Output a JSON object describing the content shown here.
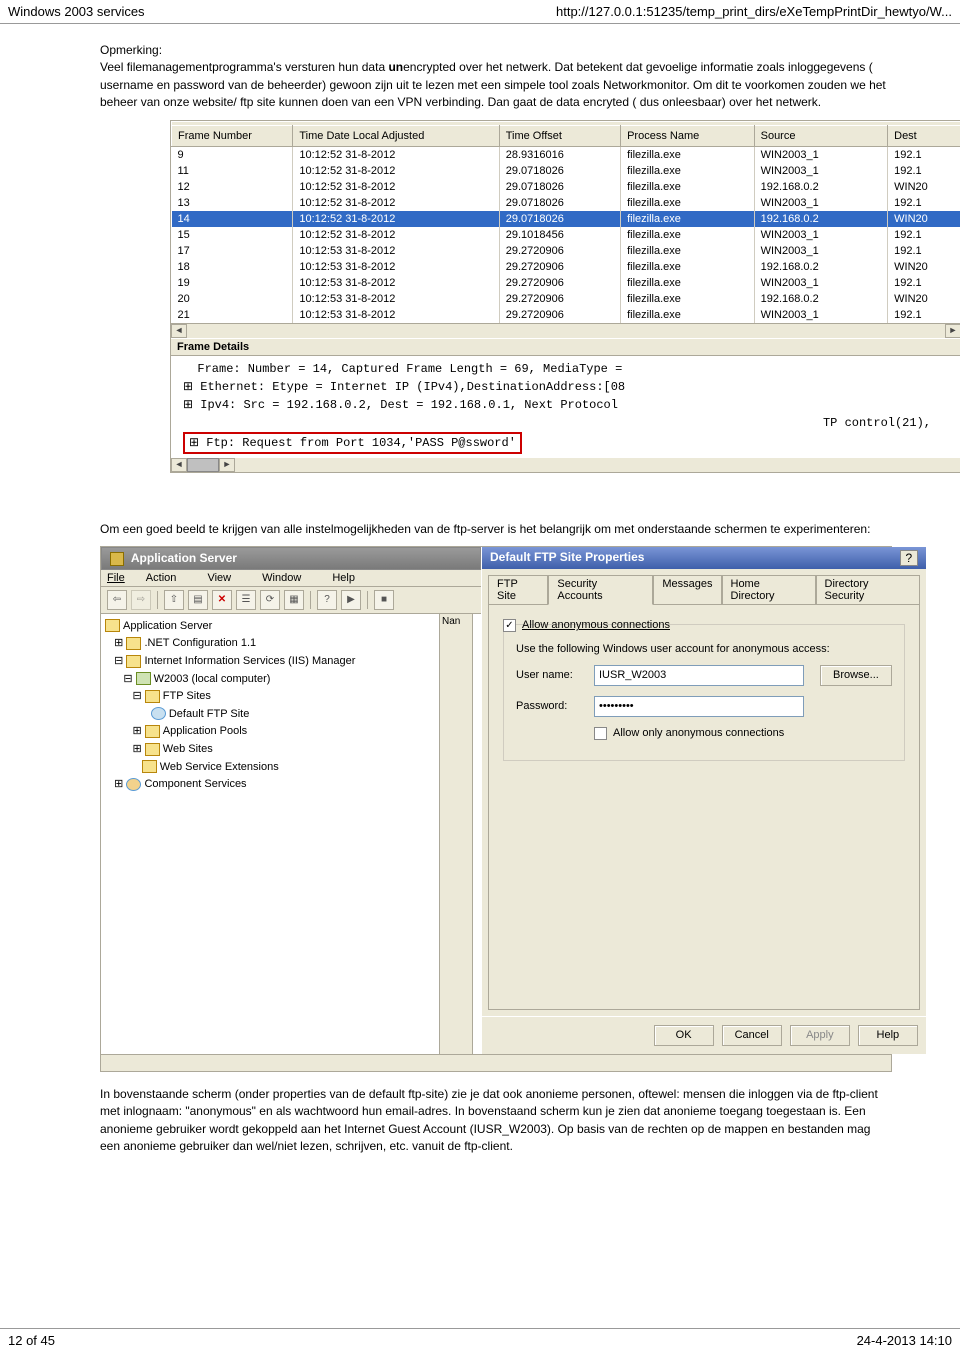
{
  "header": {
    "title": "Windows 2003 services",
    "url": "http://127.0.0.1:51235/temp_print_dirs/eXeTempPrintDir_hewtyo/W..."
  },
  "intro": {
    "label": "Opmerking:",
    "text_pre": "Veel filemanagementprogramma's versturen hun data ",
    "text_bold": "un",
    "text_post": "encrypted over het netwerk. Dat betekent dat gevoelige informatie zoals inloggegevens ( username en password van de beheerder) gewoon zijn uit te lezen met een simpele tool zoals Networkmonitor. Om dit te voorkomen zouden we het beheer van onze website/ ftp site kunnen doen van een VPN verbinding. Dan gaat de data encryted ( dus onleesbaar) over het netwerk."
  },
  "netmon": {
    "columns": [
      "Frame Number",
      "Time Date Local Adjusted",
      "Time Offset",
      "Process Name",
      "Source",
      "Dest"
    ],
    "rows": [
      [
        "9",
        "10:12:52 31-8-2012",
        "28.9316016",
        "filezilla.exe",
        "WIN2003_1",
        "192.1"
      ],
      [
        "11",
        "10:12:52 31-8-2012",
        "29.0718026",
        "filezilla.exe",
        "WIN2003_1",
        "192.1"
      ],
      [
        "12",
        "10:12:52 31-8-2012",
        "29.0718026",
        "filezilla.exe",
        "192.168.0.2",
        "WIN20"
      ],
      [
        "13",
        "10:12:52 31-8-2012",
        "29.0718026",
        "filezilla.exe",
        "WIN2003_1",
        "192.1"
      ],
      [
        "14",
        "10:12:52 31-8-2012",
        "29.0718026",
        "filezilla.exe",
        "192.168.0.2",
        "WIN20"
      ],
      [
        "15",
        "10:12:52 31-8-2012",
        "29.1018456",
        "filezilla.exe",
        "WIN2003_1",
        "192.1"
      ],
      [
        "17",
        "10:12:53 31-8-2012",
        "29.2720906",
        "filezilla.exe",
        "WIN2003_1",
        "192.1"
      ],
      [
        "18",
        "10:12:53 31-8-2012",
        "29.2720906",
        "filezilla.exe",
        "192.168.0.2",
        "WIN20"
      ],
      [
        "19",
        "10:12:53 31-8-2012",
        "29.2720906",
        "filezilla.exe",
        "WIN2003_1",
        "192.1"
      ],
      [
        "20",
        "10:12:53 31-8-2012",
        "29.2720906",
        "filezilla.exe",
        "192.168.0.2",
        "WIN20"
      ],
      [
        "21",
        "10:12:53 31-8-2012",
        "29.2720906",
        "filezilla.exe",
        "WIN2003_1",
        "192.1"
      ]
    ],
    "selected_index": 4,
    "frame_details_header": "Frame Details",
    "details": {
      "l1": "  Frame: Number = 14, Captured Frame Length = 69, MediaType =",
      "l2": "⊞ Ethernet: Etype = Internet IP (IPv4),DestinationAddress:[08",
      "l3": "⊞ Ipv4: Src = 192.168.0.2, Dest = 192.168.0.1, Next Protocol",
      "l4_tail": "TP control(21),",
      "l5": "⊞ Ftp: Request from Port 1034,'PASS P@ssword'"
    }
  },
  "mid_text": "Om een goed beeld te krijgen van alle instelmogelijkheden van de ftp-server is het belangrijk om met onderstaande schermen te experimenteren:",
  "appserver": {
    "title": "Application Server",
    "menu": [
      "File",
      "Action",
      "View",
      "Window",
      "Help"
    ],
    "tree": {
      "l0": "Application Server",
      "l1": ".NET Configuration 1.1",
      "l2": "Internet Information Services (IIS) Manager",
      "l3": "W2003 (local computer)",
      "l4": "FTP Sites",
      "l5": "Default FTP Site",
      "l6": "Application Pools",
      "l7": "Web Sites",
      "l8": "Web Service Extensions",
      "l9": "Component Services"
    },
    "name_col": "Nan",
    "dialog": {
      "title": "Default FTP Site Properties",
      "help": "?",
      "tabs": [
        "FTP Site",
        "Security Accounts",
        "Messages",
        "Home Directory",
        "Directory Security"
      ],
      "active_tab": 1,
      "allow_anon_label": "Allow anonymous connections",
      "allow_anon_checked": true,
      "desc": "Use the following Windows user account for anonymous access:",
      "user_label": "User name:",
      "user_value": "IUSR_W2003",
      "browse_label": "Browse...",
      "pass_label": "Password:",
      "pass_value": "•••••••••",
      "allow_only_label": "Allow only anonymous connections",
      "allow_only_checked": false,
      "buttons": {
        "ok": "OK",
        "cancel": "Cancel",
        "apply": "Apply",
        "help": "Help"
      }
    }
  },
  "outro": "In bovenstaande scherm (onder properties van de default ftp-site) zie je dat ook anonieme personen, oftewel: mensen die inloggen via de ftp-client met inlognaam: \"anonymous\" en als wachtwoord hun email-adres. In bovenstaand scherm kun je zien dat anonieme toegang toegestaan is. Een anonieme gebruiker wordt gekoppeld aan het Internet Guest Account (IUSR_W2003). Op basis van de rechten op de mappen en bestanden mag een anonieme gebruiker dan wel/niet lezen, schrijven, etc. vanuit de ftp-client.",
  "footer": {
    "page": "12 of 45",
    "datetime": "24-4-2013 14:10"
  }
}
